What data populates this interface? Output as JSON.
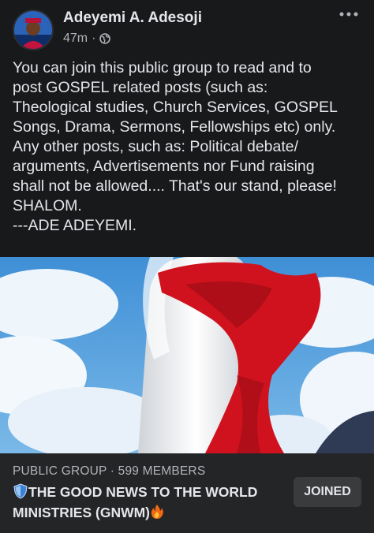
{
  "post": {
    "author": "Adeyemi A. Adesoji",
    "time": "47m",
    "separator": "·",
    "privacy_icon": "globe-icon",
    "more_icon": "more-horizontal-icon",
    "text_lines": [
      "You can join this public group to read and to",
      "post GOSPEL related posts (such as:",
      "Theological studies, Church Services, GOSPEL",
      "Songs, Drama, Sermons, Fellowships etc) only.",
      "Any other posts, such as: Political debate/",
      "arguments, Advertisements nor Fund raising",
      "shall not be allowed.... That's our stand, please!",
      "SHALOM.",
      "---ADE ADEYEMI."
    ]
  },
  "group": {
    "meta": "PUBLIC GROUP · 599 MEMBERS",
    "name_line1": "THE GOOD NEWS TO THE WORLD",
    "name_line2": "MINISTRIES (GNWM)",
    "leading_icon": "shield-emoji-icon",
    "trailing_icon": "fire-emoji-icon",
    "joined_label": "JOINED"
  },
  "colors": {
    "background": "#18191a",
    "card": "#242526",
    "button": "#3a3b3c",
    "primary_text": "#e4e6eb",
    "secondary_text": "#b0b3b8"
  }
}
